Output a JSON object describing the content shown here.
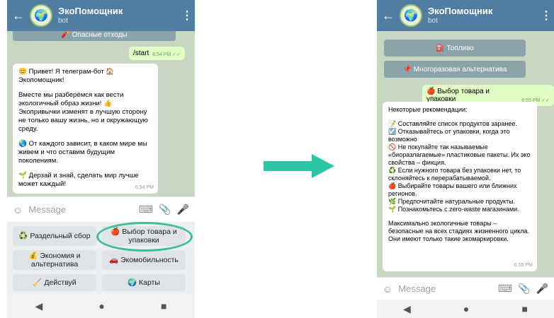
{
  "header": {
    "title": "ЭкоПомощник",
    "subtitle": "bot",
    "back_icon": "←",
    "menu_icon": "⋮",
    "avatar_emoji": "🌍"
  },
  "left": {
    "chat_top_button": "🧨 Опасные отходы",
    "user_msg": {
      "text": "/start",
      "time": "6:54 PM ✓✓"
    },
    "bot_msg": {
      "paragraphs": [
        "😊 Привет! Я телеграм-бот 🏠 Экопомощник!",
        "Вместе мы разберёмся как вести экологичный образ жизни! 👍 Экопривычки изменят в лучшую сторону не только вашу жизнь, но и окружающую среду.",
        "🌏 От каждого зависит, в каком мире мы живем и что оставим будущим поколениям.",
        "🌱 Дерзай и знай, сделать мир лучше может каждый!"
      ],
      "time": "6:54 PM"
    },
    "composer_placeholder": "Message",
    "keyboard": [
      "♻️ Раздельный сбор",
      "🍎 Выбор товара и упаковки",
      "💰 Экономия и альтернатива",
      "🚗 Экомобильность",
      "🧹 Действуй",
      "🌍 Карты"
    ]
  },
  "right": {
    "chat_buttons": [
      "⛽ Топливо",
      "📌 Многоразовая альтернатива"
    ],
    "user_msg": {
      "text": "🍎 Выбор товара и упаковки",
      "time": "6:55 PM ✓✓"
    },
    "bot_msg": {
      "paragraphs": [
        "Некоторые рекомендации:",
        "📝 Составляйте список продуктов заранее.\n☑️ Отказывайтесь от упаковки, когда это возможно\n🚫 Не покупайте так называемые «биоразлагаемые» пластиковые пакеты. Их эко свойства – фикция.\n♻️ Если нужного товара без упаковки нет, то склоняйтесь к перерабатываемой.\n🍎 Выбирайте товары вашего или ближних регионов.\n🌿 Предпочитайте натуральные продукты.\n🌱 Познакомьтесь с zero-waste магазинами.",
        "Максимально экологичные товары – безопасные на всех стадиях жизненного цикла. Они имеют только такие экомаркировки."
      ],
      "time": "6:55 PM"
    },
    "composer_placeholder": "Message"
  },
  "navbar": {
    "back": "◀",
    "home": "●",
    "recents": "■"
  },
  "icons": {
    "emoji": "emoji-sticker-icon",
    "keyboard": "keyboard-icon",
    "attach": "paperclip-icon",
    "mic": "microphone-icon"
  },
  "colors": {
    "header": "#517da2",
    "chat_bg": "#c9d6c1",
    "highlight": "#3bbf94",
    "arrow": "#2ec4a6"
  }
}
